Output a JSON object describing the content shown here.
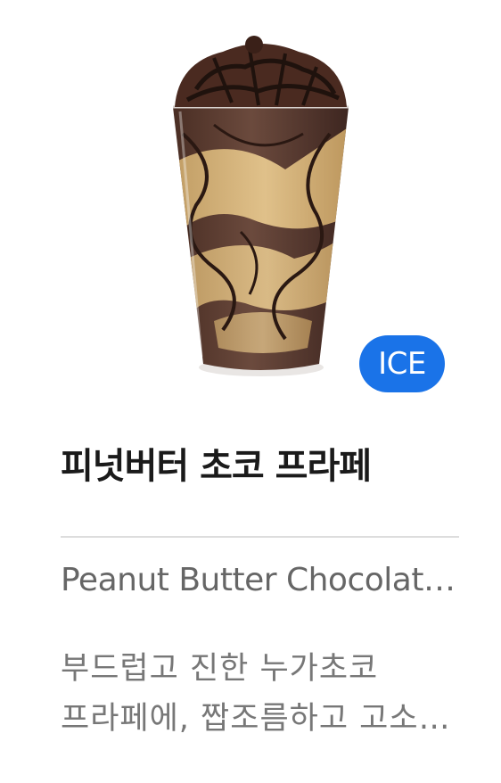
{
  "product": {
    "name": "피넛버터 초코 프라페",
    "english_name": "Peanut Butter Chocolate Frappe",
    "description": "부드럽고 진한 누가초코 프라페에, 짭조름하고 고소한 피넛버터를 더한 프라페",
    "temperature_badge": "ICE",
    "image_icon": "frappe-cup-image"
  },
  "colors": {
    "badge_bg": "#1a73e8",
    "name_text": "#1a1a1a",
    "secondary_text": "#666666",
    "description_text": "#777777",
    "divider": "#dddddd"
  }
}
